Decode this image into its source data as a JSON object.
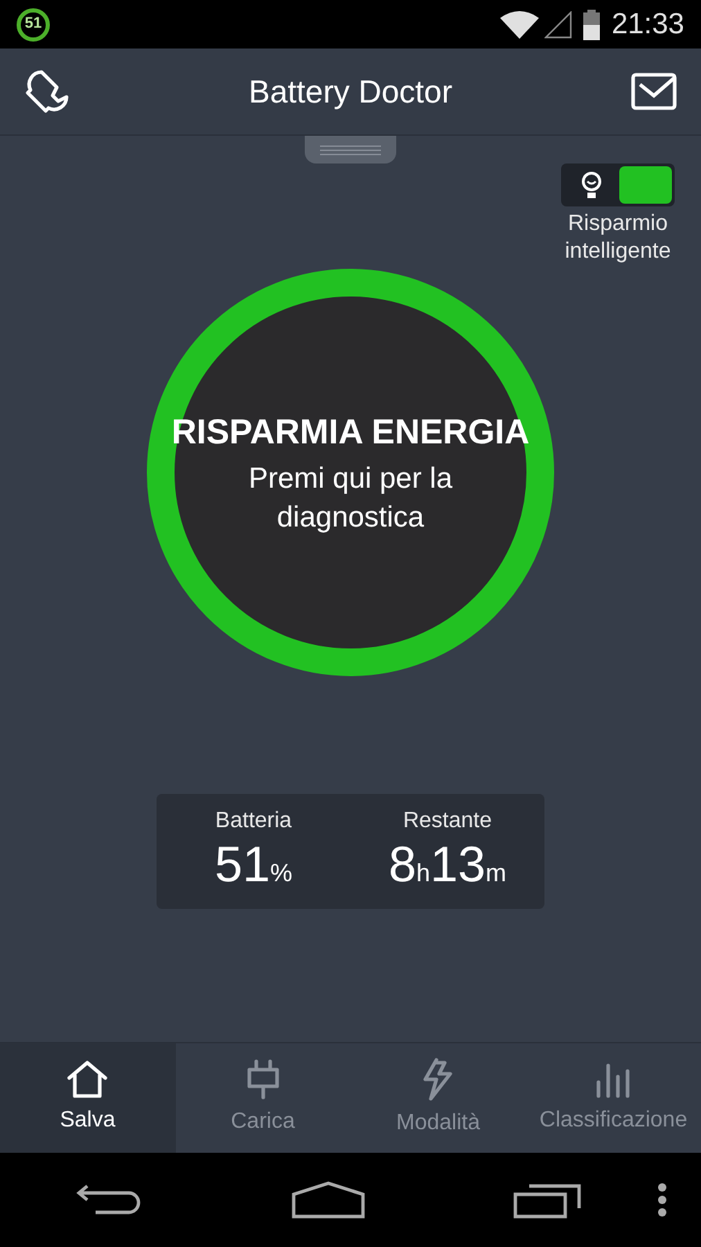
{
  "status_bar": {
    "badge": "51",
    "time": "21:33"
  },
  "header": {
    "title": "Battery Doctor"
  },
  "smart_saving": {
    "on": true,
    "label": "Risparmio intelligente"
  },
  "main_button": {
    "title": "RISPARMIA ENERGIA",
    "subtitle": "Premi qui per la diagnostica"
  },
  "stats": [
    {
      "label": "Batteria",
      "parts": [
        {
          "kind": "number",
          "text": "51"
        },
        {
          "kind": "unit",
          "text": "%"
        }
      ]
    },
    {
      "label": "Restante",
      "parts": [
        {
          "kind": "number",
          "text": "8"
        },
        {
          "kind": "unit",
          "text": "h"
        },
        {
          "kind": "number",
          "text": "13"
        },
        {
          "kind": "unit",
          "text": "m"
        }
      ]
    }
  ],
  "tabs": [
    {
      "kind": "home",
      "label": "Salva",
      "selected": true
    },
    {
      "kind": "plug",
      "label": "Carica",
      "selected": false
    },
    {
      "kind": "bolt",
      "label": "Modalità",
      "selected": false
    },
    {
      "kind": "chart",
      "label": "Classificazione",
      "selected": false
    }
  ]
}
